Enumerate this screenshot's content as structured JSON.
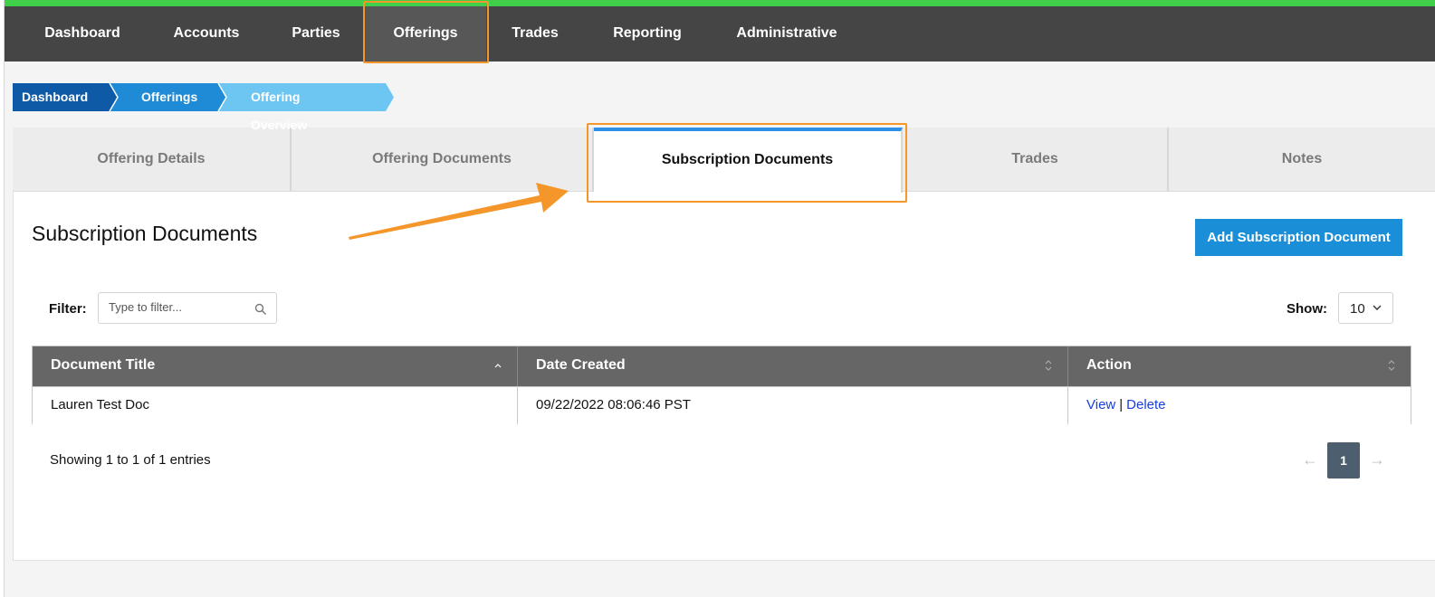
{
  "nav": {
    "items": [
      {
        "label": "Dashboard"
      },
      {
        "label": "Accounts"
      },
      {
        "label": "Parties"
      },
      {
        "label": "Offerings"
      },
      {
        "label": "Trades"
      },
      {
        "label": "Reporting"
      },
      {
        "label": "Administrative"
      }
    ],
    "active": "Offerings"
  },
  "breadcrumb": [
    {
      "label": "Dashboard",
      "color": "#0e5aa7"
    },
    {
      "label": "Offerings",
      "color": "#1f8bd6"
    },
    {
      "label": "Offering Overview",
      "color": "#6cc6f1"
    }
  ],
  "tabs": [
    {
      "label": "Offering Details"
    },
    {
      "label": "Offering Documents"
    },
    {
      "label": "Subscription Documents"
    },
    {
      "label": "Trades"
    },
    {
      "label": "Notes"
    }
  ],
  "active_tab": "Subscription Documents",
  "section": {
    "title": "Subscription Documents",
    "add_button": "Add Subscription Document"
  },
  "filter": {
    "label": "Filter:",
    "placeholder": "Type to filter...",
    "value": ""
  },
  "show": {
    "label": "Show:",
    "value": "10"
  },
  "table": {
    "columns": [
      "Document Title",
      "Date Created",
      "Action"
    ],
    "rows": [
      {
        "title": "Lauren Test Doc",
        "date": "09/22/2022 08:06:46 PST",
        "view": "View",
        "separator": "|",
        "delete": "Delete"
      }
    ]
  },
  "pagination": {
    "summary": "Showing 1 to 1 of 1 entries",
    "prev": "←",
    "page": "1",
    "next": "→"
  },
  "colors": {
    "highlight": "#f5962a",
    "nav_bg": "#454545",
    "accent": "#1a8fd8",
    "top_stripe": "#3fcf48"
  }
}
